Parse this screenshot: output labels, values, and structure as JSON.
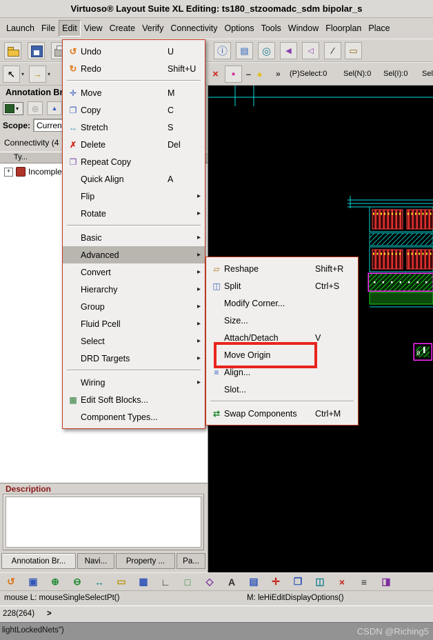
{
  "window": {
    "title": "Virtuoso® Layout Suite XL Editing: ts180_stzoomadc_sdm bipolar_s"
  },
  "menubar": {
    "items": [
      {
        "label": "Launch"
      },
      {
        "label": "File"
      },
      {
        "label": "Edit"
      },
      {
        "label": "View"
      },
      {
        "label": "Create"
      },
      {
        "label": "Verify"
      },
      {
        "label": "Connectivity"
      },
      {
        "label": "Options"
      },
      {
        "label": "Tools"
      },
      {
        "label": "Window"
      },
      {
        "label": "Floorplan"
      },
      {
        "label": "Place"
      }
    ]
  },
  "toolbar": {
    "overflow_chevron": "»",
    "selection_counters": [
      "(P)Select:0",
      "Sel(N):0",
      "Sel(I):0",
      "Sel"
    ]
  },
  "edit_menu": {
    "items": [
      {
        "label": "Undo",
        "shortcut": "U",
        "icon": "undo-icon"
      },
      {
        "label": "Redo",
        "shortcut": "Shift+U",
        "icon": "redo-icon"
      },
      {
        "label": "Move",
        "shortcut": "M",
        "icon": "move-icon"
      },
      {
        "label": "Copy",
        "shortcut": "C",
        "icon": "copy-icon"
      },
      {
        "label": "Stretch",
        "shortcut": "S",
        "icon": "stretch-icon"
      },
      {
        "label": "Delete",
        "shortcut": "Del",
        "icon": "delete-icon"
      },
      {
        "label": "Repeat Copy",
        "icon": "repeat-copy-icon"
      },
      {
        "label": "Quick Align",
        "shortcut": "A"
      },
      {
        "label": "Flip",
        "submenu": true
      },
      {
        "label": "Rotate",
        "submenu": true
      },
      {
        "label": "Basic",
        "submenu": true
      },
      {
        "label": "Advanced",
        "submenu": true,
        "selected": true
      },
      {
        "label": "Convert",
        "submenu": true
      },
      {
        "label": "Hierarchy",
        "submenu": true
      },
      {
        "label": "Group",
        "submenu": true
      },
      {
        "label": "Fluid Pcell",
        "submenu": true
      },
      {
        "label": "Select",
        "submenu": true
      },
      {
        "label": "DRD Targets",
        "submenu": true
      },
      {
        "label": "Wiring",
        "submenu": true
      },
      {
        "label": "Edit Soft Blocks...",
        "icon": "edit-soft-blocks-icon"
      },
      {
        "label": "Component Types..."
      }
    ]
  },
  "advanced_submenu": {
    "items": [
      {
        "label": "Reshape",
        "shortcut": "Shift+R",
        "icon": "reshape-icon"
      },
      {
        "label": "Split",
        "shortcut": "Ctrl+S",
        "icon": "split-icon"
      },
      {
        "label": "Modify Corner..."
      },
      {
        "label": "Size..."
      },
      {
        "label": "Attach/Detach",
        "shortcut": "V"
      },
      {
        "label": "Move Origin",
        "annotated": true
      },
      {
        "label": "Align...",
        "icon": "align-icon"
      },
      {
        "label": "Slot..."
      },
      {
        "label": "Swap Components",
        "shortcut": "Ctrl+M",
        "icon": "swap-components-icon"
      }
    ]
  },
  "left_panel": {
    "header": "Annotation Br",
    "scope_label": "Scope:",
    "scope_value": "Current",
    "connectivity_label": "Connectivity (4",
    "tree_header": "Ty...",
    "tree_items": [
      {
        "label": "Incomplete...",
        "expander": "+"
      }
    ],
    "description_label": "Description",
    "tabs": [
      {
        "label": "Annotation Br..."
      },
      {
        "label": "Navi..."
      },
      {
        "label": "Property ..."
      },
      {
        "label": "Pa..."
      }
    ]
  },
  "canvas": {
    "origin_label": "0"
  },
  "bottom_toolbar": {
    "icons": [
      {
        "name": "redraw-icon",
        "glyph": "↺"
      },
      {
        "name": "zoom-fit-icon",
        "glyph": "▣"
      },
      {
        "name": "zoom-in-icon",
        "glyph": "⊕"
      },
      {
        "name": "zoom-out-icon",
        "glyph": "⊖"
      },
      {
        "name": "pan-icon",
        "glyph": "↔"
      },
      {
        "name": "ruler-icon",
        "glyph": "▭"
      },
      {
        "name": "create-instance-icon",
        "glyph": "▦"
      },
      {
        "name": "create-wire-icon",
        "glyph": "∟"
      },
      {
        "name": "create-rect-icon",
        "glyph": "□"
      },
      {
        "name": "create-polygon-icon",
        "glyph": "◇"
      },
      {
        "name": "create-label-icon",
        "glyph": "A"
      },
      {
        "name": "create-via-icon",
        "glyph": "▤"
      },
      {
        "name": "move-tool-icon",
        "glyph": "✛"
      },
      {
        "name": "copy-tool-icon",
        "glyph": "❐"
      },
      {
        "name": "stretch-tool-icon",
        "glyph": "◫"
      },
      {
        "name": "delete-tool-icon",
        "glyph": "×"
      },
      {
        "name": "properties-icon",
        "glyph": "≡"
      },
      {
        "name": "options-icon",
        "glyph": "◨"
      }
    ]
  },
  "status_bar": {
    "left": "mouse L: mouseSingleSelectPt()",
    "middle": "M: leHiEditDisplayOptions()"
  },
  "command_line": {
    "coords": "228(264)",
    "prompt": ">"
  },
  "footer": {
    "text": "lightLockedNets\")",
    "watermark": "CSDN @Riching5"
  },
  "colors": {
    "annotation_red": "#e8251c",
    "menu_border": "#c23a20",
    "canvas_cyan": "#00dede",
    "canvas_red": "#e03030",
    "canvas_magenta": "#ff2bff",
    "canvas_green": "#1ad41a"
  }
}
